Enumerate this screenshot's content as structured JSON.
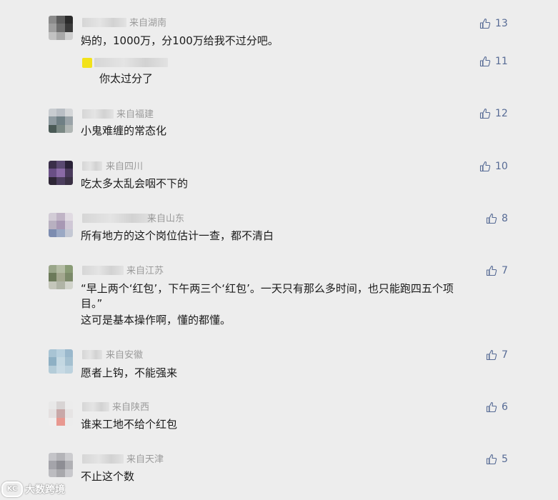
{
  "comments": [
    {
      "region": "来自湖南",
      "text": "妈的，1000万，分100万给我不过分吧。",
      "likes": "13",
      "reply": {
        "text": "你太过分了",
        "likes": "11"
      }
    },
    {
      "region": "来自福建",
      "text": "小鬼难缠的常态化",
      "likes": "12"
    },
    {
      "region": "来自四川",
      "text": "吃太多太乱会咽不下的",
      "likes": "10"
    },
    {
      "region": "来自山东",
      "text": "所有地方的这个岗位估计一查，都不清白",
      "likes": "8"
    },
    {
      "region": "来自江苏",
      "text_lines": [
        "“早上两个‘红包’，下午两三个‘红包’。一天只有那么多时间，也只能跑四五个项",
        "目。”",
        "这可是基本操作啊，懂的都懂。"
      ],
      "likes": "7"
    },
    {
      "region": "来自安徽",
      "text": "愿者上钩，不能强来",
      "likes": "7"
    },
    {
      "region": "来自陕西",
      "text": "谁来工地不给个红包",
      "likes": "6"
    },
    {
      "region": "来自天津",
      "text": "不止这个数",
      "likes": "5"
    }
  ],
  "watermark": {
    "logo_text": "KC",
    "label": "大数跨境"
  },
  "colors": {
    "background": "#ededed",
    "like": "#576b95",
    "region": "#9a9a9a",
    "text": "#1a1a1a"
  },
  "icons": {
    "like": "thumbs-up-icon"
  }
}
